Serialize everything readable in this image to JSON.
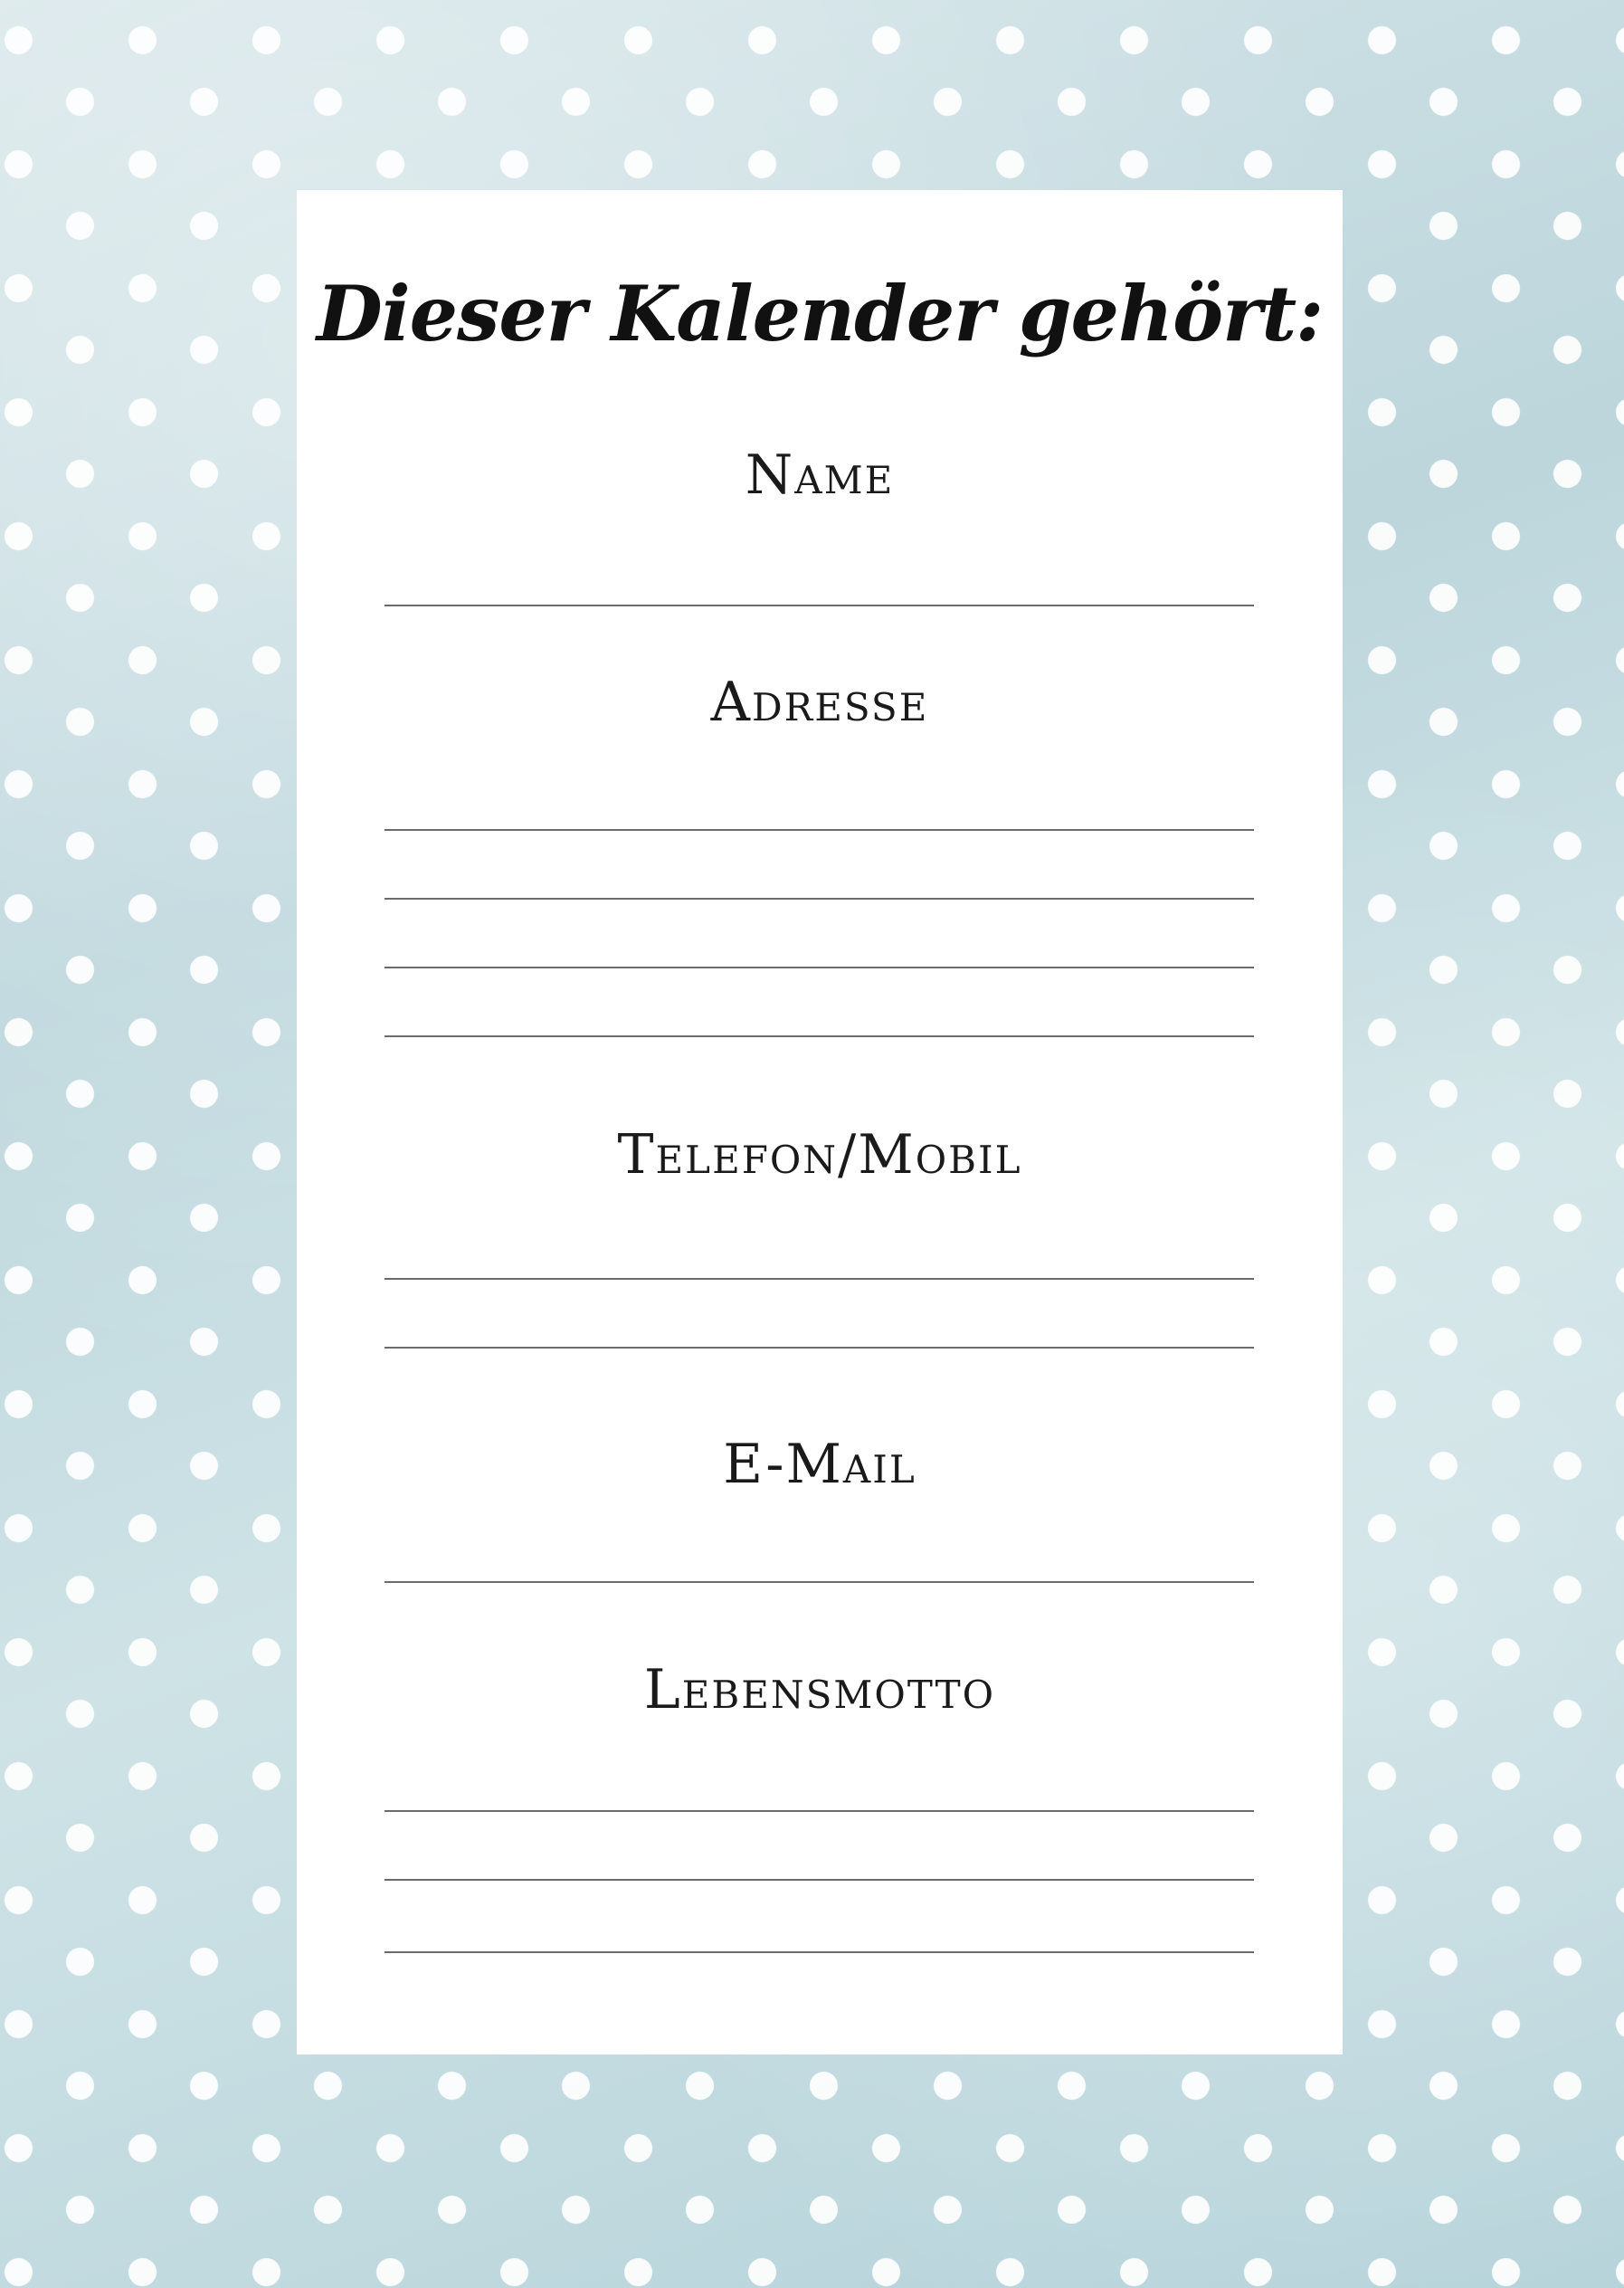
{
  "page": {
    "title": "Dieser Kalender gehört:",
    "fields": [
      {
        "label": "Name",
        "lines": 1
      },
      {
        "label": "Adresse",
        "lines": 4
      },
      {
        "label": "Telefon/Mobil",
        "lines": 2
      },
      {
        "label": "E-Mail",
        "lines": 1
      },
      {
        "label": "Lebensmotto",
        "lines": 3
      }
    ]
  },
  "colors": {
    "background": "#bcd6dc",
    "dots": "#ffffff",
    "card": "#ffffff",
    "text": "#111111",
    "lines": "#6b6b6b"
  }
}
